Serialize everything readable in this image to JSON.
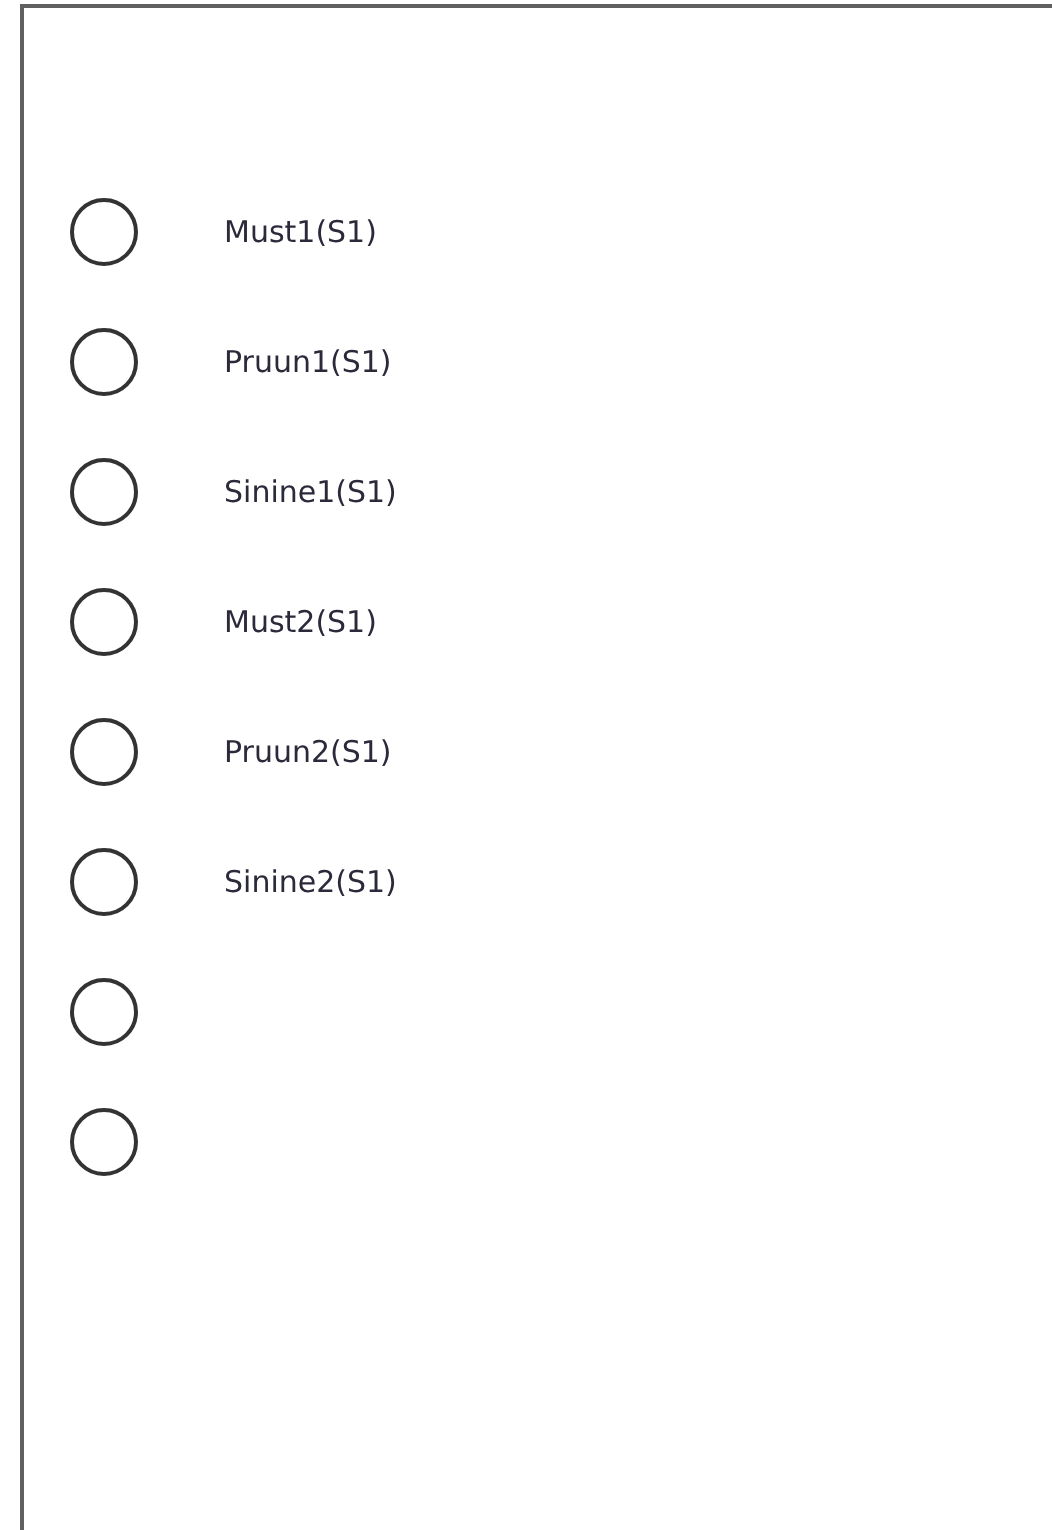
{
  "options": [
    {
      "label": "Must1(S1)",
      "selected": false
    },
    {
      "label": "Pruun1(S1)",
      "selected": false
    },
    {
      "label": "Sinine1(S1)",
      "selected": false
    },
    {
      "label": "Must2(S1)",
      "selected": false
    },
    {
      "label": "Pruun2(S1)",
      "selected": false
    },
    {
      "label": "Sinine2(S1)",
      "selected": false
    },
    {
      "selected": false
    },
    {
      "selected": false
    }
  ]
}
